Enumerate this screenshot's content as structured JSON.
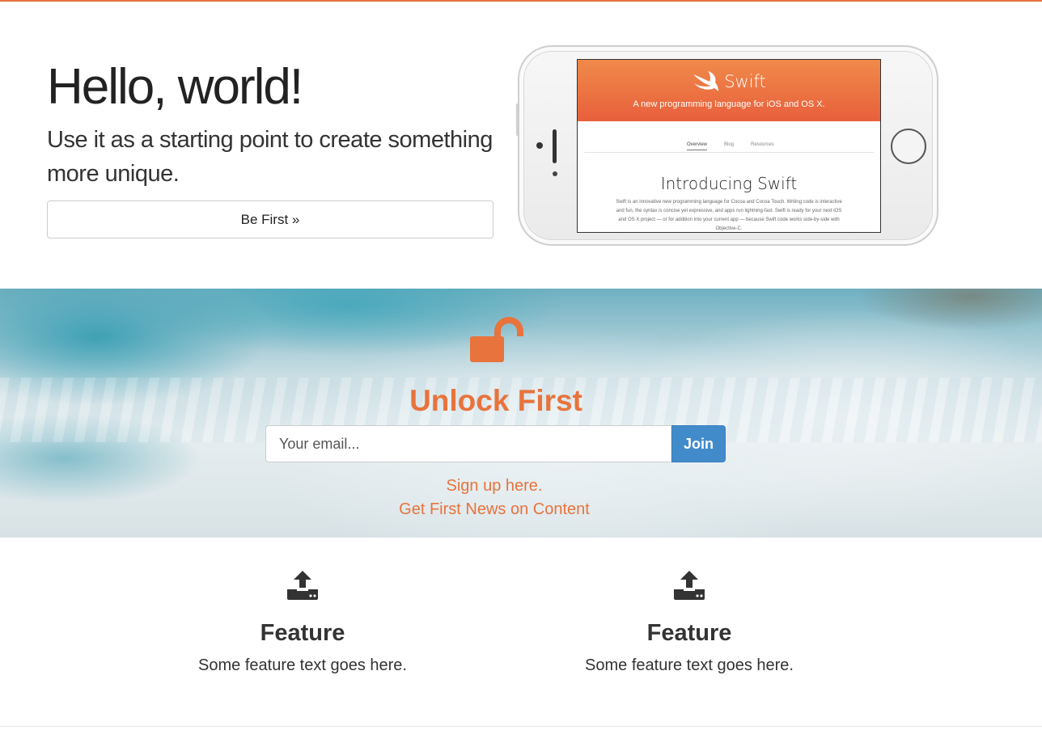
{
  "colors": {
    "accent": "#e8733c",
    "primary_button": "#428bca"
  },
  "hero": {
    "title": "Hello, world!",
    "subtitle": "Use it as a starting point to create something more unique.",
    "cta_label": "Be First »"
  },
  "phone_screen": {
    "brand": "Swift",
    "tagline": "A new programming language for iOS and OS X.",
    "nav": [
      "Overview",
      "Blog",
      "Resources"
    ],
    "heading": "Introducing Swift",
    "body": "Swift is an innovative new programming language for Cocoa and Cocoa Touch. Writing code is interactive and fun, the syntax is concise yet expressive, and apps run lightning-fast. Swift is ready for your next iOS and OS X project — or for addition into your current app — because Swift code works side-by-side with Objective-C."
  },
  "signup": {
    "icon": "unlock-icon",
    "title": "Unlock First",
    "email_placeholder": "Your email...",
    "join_label": "Join",
    "link1": "Sign up here.",
    "link2": "Get First News on Content"
  },
  "features": [
    {
      "icon": "upload-icon",
      "title": "Feature",
      "text": "Some feature text goes here."
    },
    {
      "icon": "upload-icon",
      "title": "Feature",
      "text": "Some feature text goes here."
    }
  ]
}
